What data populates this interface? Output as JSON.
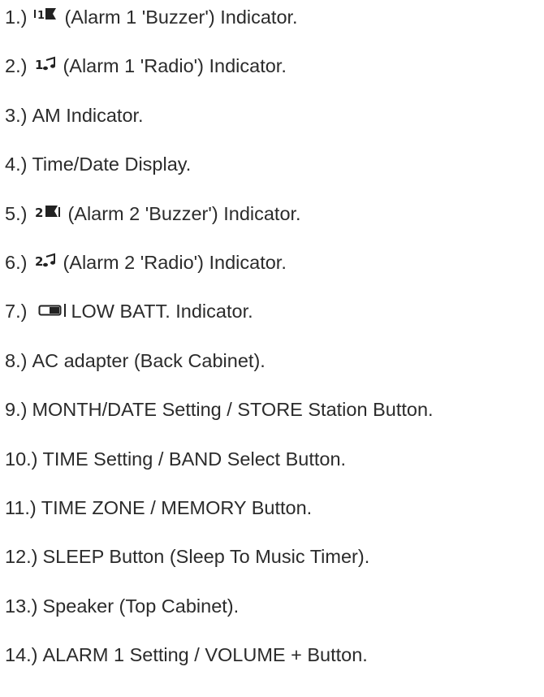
{
  "items": [
    {
      "num": "1.)",
      "icon": "alarm-1-buzzer-icon",
      "text": "(Alarm 1 'Buzzer') Indicator."
    },
    {
      "num": "2.)",
      "icon": "alarm-1-radio-icon",
      "text": "(Alarm 1 'Radio') Indicator."
    },
    {
      "num": "3.)",
      "icon": "",
      "text": "AM Indicator."
    },
    {
      "num": "4.)",
      "icon": "",
      "text": "Time/Date Display."
    },
    {
      "num": "5.)",
      "icon": "alarm-2-buzzer-icon",
      "text": "(Alarm 2 'Buzzer') Indicator."
    },
    {
      "num": "6.)",
      "icon": "alarm-2-radio-icon",
      "text": "(Alarm 2 'Radio') Indicator."
    },
    {
      "num": "7.)",
      "icon": "battery-icon",
      "text": "LOW BATT. Indicator."
    },
    {
      "num": "8.)",
      "icon": "",
      "text": "AC adapter (Back Cabinet)."
    },
    {
      "num": "9.)",
      "icon": "",
      "text": "MONTH/DATE Setting / STORE Station Button."
    },
    {
      "num": "10.)",
      "icon": "",
      "text": "TIME Setting / BAND Select Button."
    },
    {
      "num": "11.)",
      "icon": "",
      "text": "TIME ZONE / MEMORY Button."
    },
    {
      "num": "12.)",
      "icon": "",
      "text": "SLEEP Button (Sleep To Music Timer)."
    },
    {
      "num": "13.)",
      "icon": "",
      "text": "Speaker (Top Cabinet)."
    },
    {
      "num": "14.)",
      "icon": "",
      "text": "ALARM 1 Setting / VOLUME + Button."
    }
  ],
  "icon_color": "#222222"
}
